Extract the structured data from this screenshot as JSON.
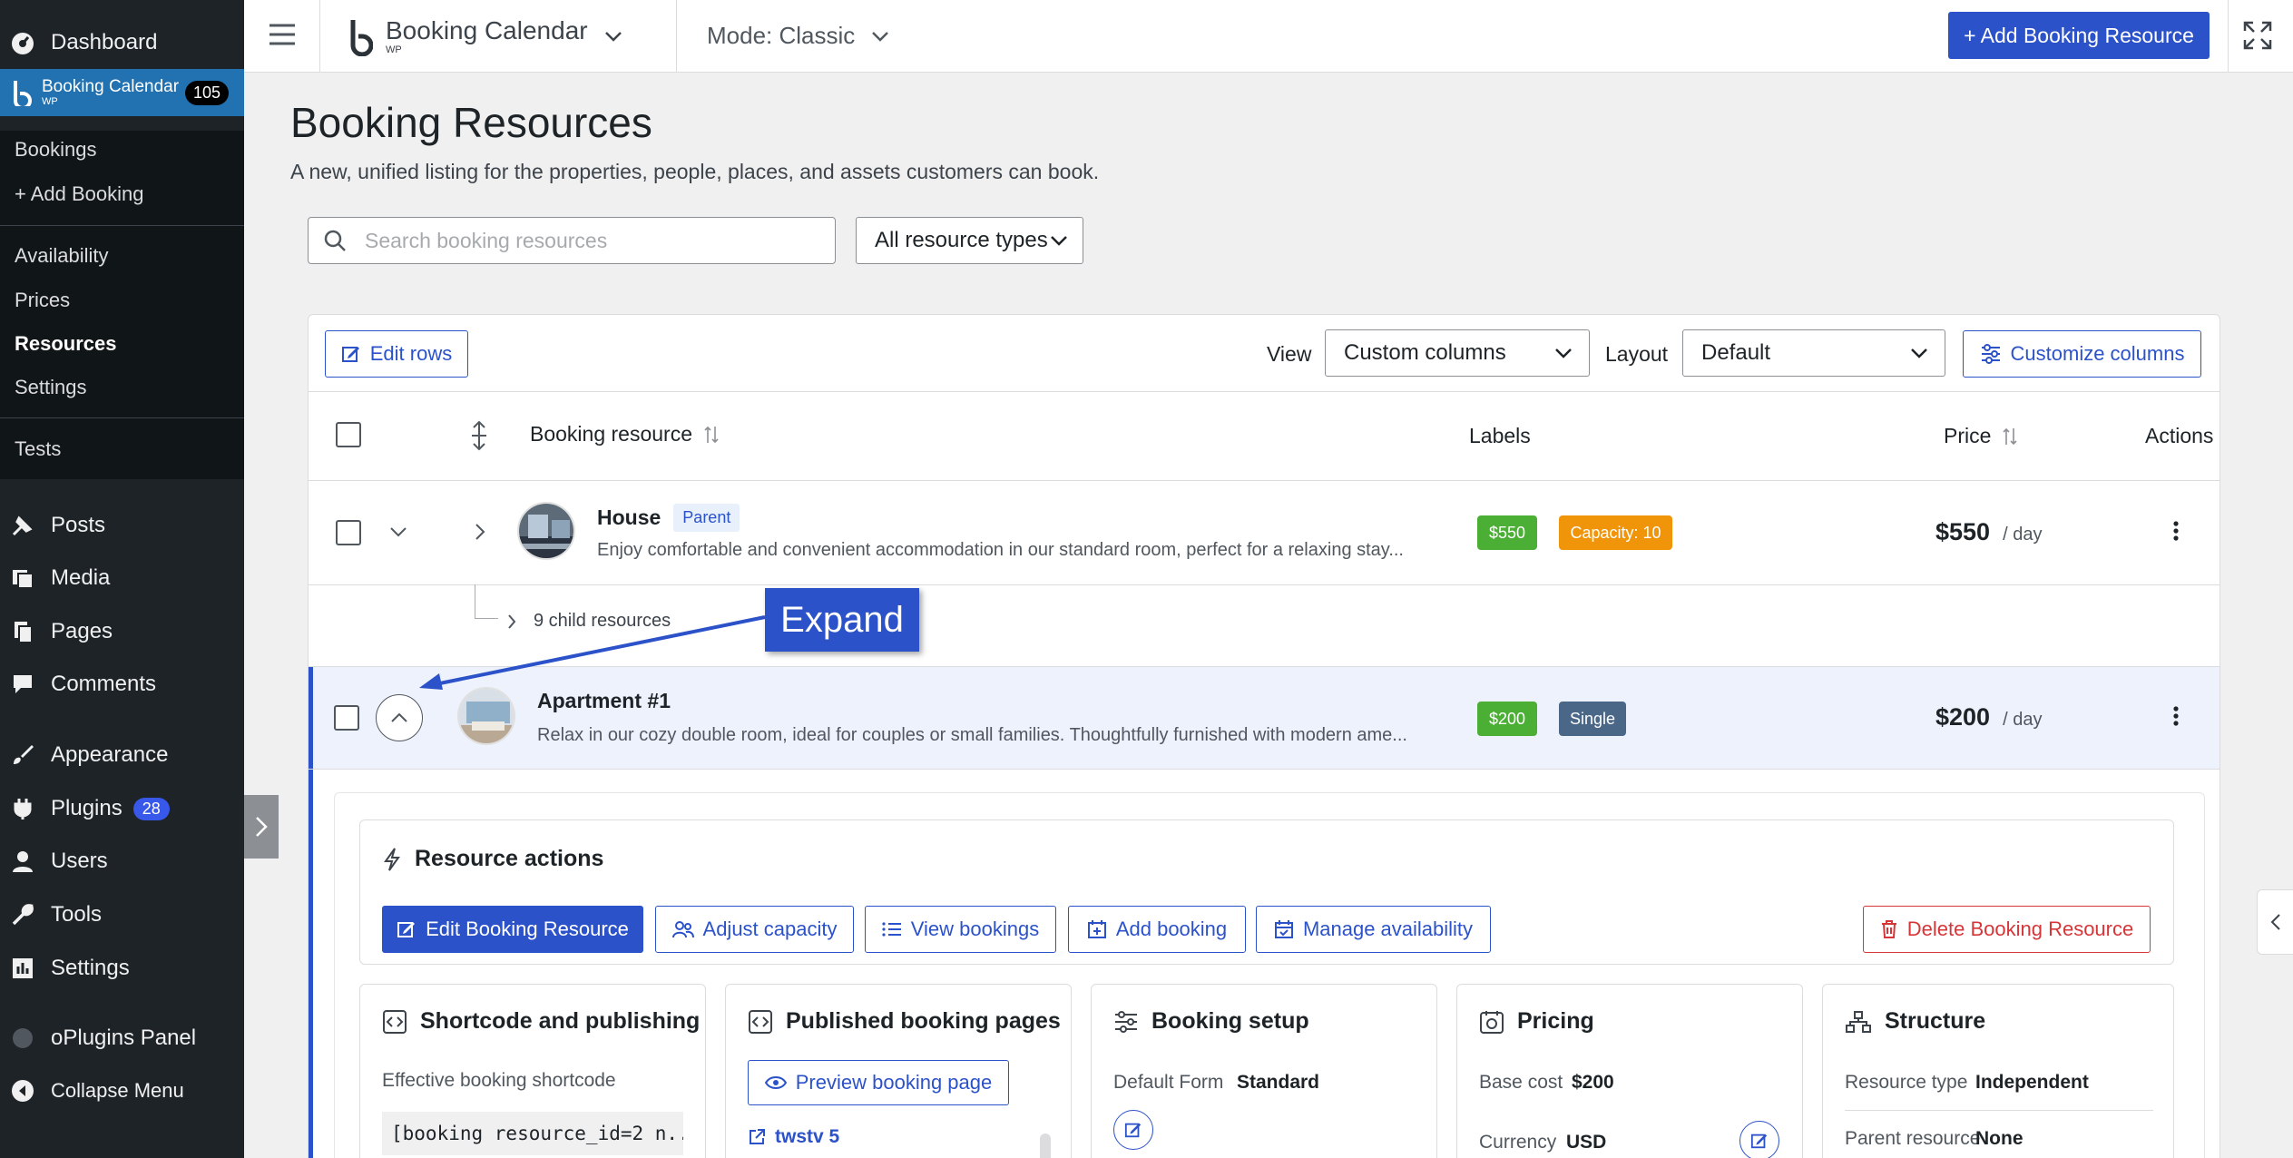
{
  "sidebar": {
    "dashboard": "Dashboard",
    "plugin_name": "Booking Calendar",
    "plugin_sub": "WP",
    "plugin_badge": "105",
    "submenu": [
      "Bookings",
      "+ Add Booking",
      "Availability",
      "Prices",
      "Resources",
      "Settings",
      "Tests"
    ],
    "items": [
      {
        "label": "Posts",
        "icon": "pin-icon"
      },
      {
        "label": "Media",
        "icon": "media-icon"
      },
      {
        "label": "Pages",
        "icon": "pages-icon"
      },
      {
        "label": "Comments",
        "icon": "comment-icon"
      },
      {
        "label": "Appearance",
        "icon": "brush-icon"
      },
      {
        "label": "Plugins",
        "icon": "plugin-icon"
      },
      {
        "label": "Users",
        "icon": "user-icon"
      },
      {
        "label": "Tools",
        "icon": "wrench-icon"
      },
      {
        "label": "Settings",
        "icon": "settings-icon"
      },
      {
        "label": "oPlugins Panel",
        "icon": "circle-icon"
      },
      {
        "label": "Collapse Menu",
        "icon": "collapse-icon"
      }
    ],
    "plugins_badge": "28"
  },
  "topbar": {
    "app_title": "Booking Calendar",
    "app_sub": "WP",
    "mode": "Mode: Classic",
    "add_resource": "+ Add Booking Resource"
  },
  "page": {
    "title": "Booking Resources",
    "subtitle": "A new, unified listing for the properties, people, places, and assets customers can book.",
    "search_placeholder": "Search booking resources",
    "type_filter": "All resource types"
  },
  "toolbar": {
    "edit_rows": "Edit rows",
    "view_label": "View",
    "view_value": "Custom columns",
    "layout_label": "Layout",
    "layout_value": "Default",
    "customize": "Customize columns"
  },
  "table": {
    "col_resource": "Booking resource",
    "col_labels": "Labels",
    "col_price": "Price",
    "col_actions": "Actions",
    "rows": [
      {
        "name": "House",
        "tag": "Parent",
        "desc": "Enjoy comfortable and convenient accommodation in our standard room, perfect for a relaxing stay...",
        "label1": "$550",
        "label2": "Capacity: 10",
        "price": "$550",
        "unit": "/ day"
      },
      {
        "name": "Apartment #1",
        "desc": "Relax in our cozy double room, ideal for couples or small families. Thoughtfully furnished with modern ame...",
        "label1": "$200",
        "label2": "Single",
        "price": "$200",
        "unit": "/ day"
      }
    ],
    "child_resources": "9 child resources"
  },
  "callout": {
    "text": "Expand"
  },
  "actions": {
    "title": "Resource actions",
    "edit": "Edit Booking Resource",
    "capacity": "Adjust capacity",
    "view": "View bookings",
    "add": "Add booking",
    "availability": "Manage availability",
    "delete": "Delete Booking Resource"
  },
  "cards": {
    "shortcode": {
      "title": "Shortcode and publishing",
      "label": "Effective booking shortcode",
      "code": "[booking resource_id=2 n..."
    },
    "pages": {
      "title": "Published booking pages",
      "preview": "Preview booking page",
      "link": "twstv 5"
    },
    "setup": {
      "title": "Booking setup",
      "form_label": "Default Form",
      "form_value": "Standard"
    },
    "pricing": {
      "title": "Pricing",
      "base_label": "Base cost",
      "base_value": "$200",
      "currency_label": "Currency",
      "currency_value": "USD"
    },
    "structure": {
      "title": "Structure",
      "type_label": "Resource type",
      "type_value": "Independent",
      "parent_label": "Parent resource",
      "parent_value": "None"
    }
  },
  "colors": {
    "accent": "#2c52c9",
    "sidebar": "#1d2327",
    "active": "#2271b1",
    "green": "#4caf35",
    "orange": "#f0940a",
    "danger": "#d63638"
  }
}
